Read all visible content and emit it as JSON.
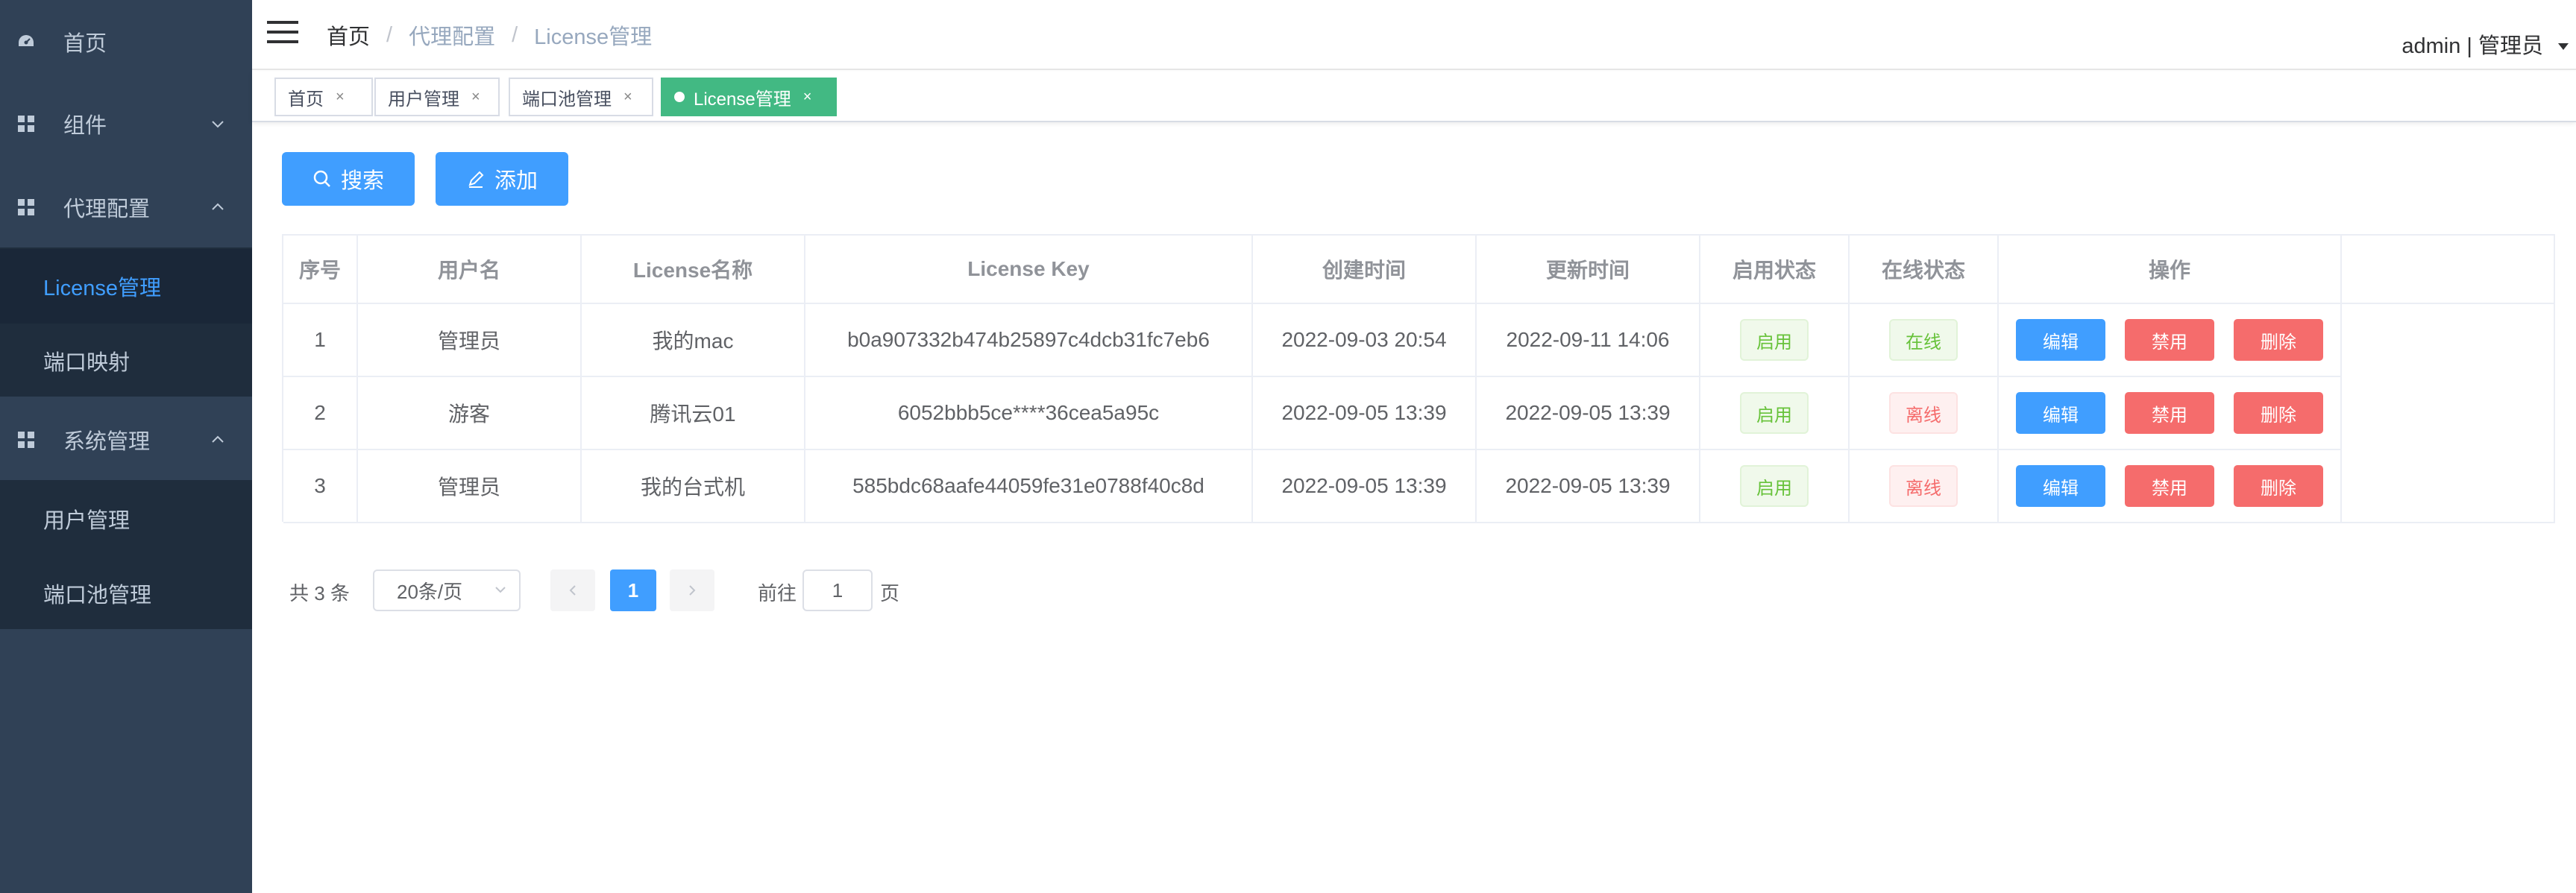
{
  "sidebar": {
    "items": [
      {
        "label": "首页",
        "icon": "dashboard-icon"
      },
      {
        "label": "组件",
        "icon": "grid-icon",
        "arrow": "chevron-down-icon"
      },
      {
        "label": "代理配置",
        "icon": "grid-icon",
        "arrow": "chevron-up-icon",
        "children": [
          {
            "label": "License管理",
            "active": true
          },
          {
            "label": "端口映射"
          }
        ]
      },
      {
        "label": "系统管理",
        "icon": "grid-icon",
        "arrow": "chevron-up-icon",
        "children": [
          {
            "label": "用户管理"
          },
          {
            "label": "端口池管理"
          }
        ]
      }
    ]
  },
  "navbar": {
    "breadcrumb": [
      "首页",
      "代理配置",
      "License管理"
    ],
    "user": "admin | 管理员"
  },
  "tags": [
    {
      "label": "首页",
      "active": false
    },
    {
      "label": "用户管理",
      "active": false
    },
    {
      "label": "端口池管理",
      "active": false
    },
    {
      "label": "License管理",
      "active": true
    }
  ],
  "toolbar": {
    "search_label": "搜索",
    "add_label": "添加"
  },
  "table": {
    "headers": [
      "序号",
      "用户名",
      "License名称",
      "License Key",
      "创建时间",
      "更新时间",
      "启用状态",
      "在线状态",
      "操作"
    ],
    "rows": [
      {
        "index": "1",
        "user": "管理员",
        "name": "我的mac",
        "key": "b0a907332b474b25897c4dcb31fc7eb6",
        "created": "2022-09-03 20:54",
        "updated": "2022-09-11 14:06",
        "enabled": "启用",
        "online": "在线",
        "online_status": "success"
      },
      {
        "index": "2",
        "user": "游客",
        "name": "腾讯云01",
        "key": "6052bbb5ce****36cea5a95c",
        "created": "2022-09-05 13:39",
        "updated": "2022-09-05 13:39",
        "enabled": "启用",
        "online": "离线",
        "online_status": "danger"
      },
      {
        "index": "3",
        "user": "管理员",
        "name": "我的台式机",
        "key": "585bdc68aafe44059fe31e0788f40c8d",
        "created": "2022-09-05 13:39",
        "updated": "2022-09-05 13:39",
        "enabled": "启用",
        "online": "离线",
        "online_status": "danger"
      }
    ],
    "actions": {
      "edit": "编辑",
      "disable": "禁用",
      "delete": "删除"
    }
  },
  "pagination": {
    "total": "共 3 条",
    "page_size": "20条/页",
    "current_page": "1",
    "goto_label": "前往",
    "goto_value": "1",
    "goto_unit": "页"
  },
  "colors": {
    "accent": "#409eff",
    "sidebar": "#304156",
    "tag_active": "#42b983",
    "danger": "#f56c6c",
    "success": "#67c23a"
  }
}
